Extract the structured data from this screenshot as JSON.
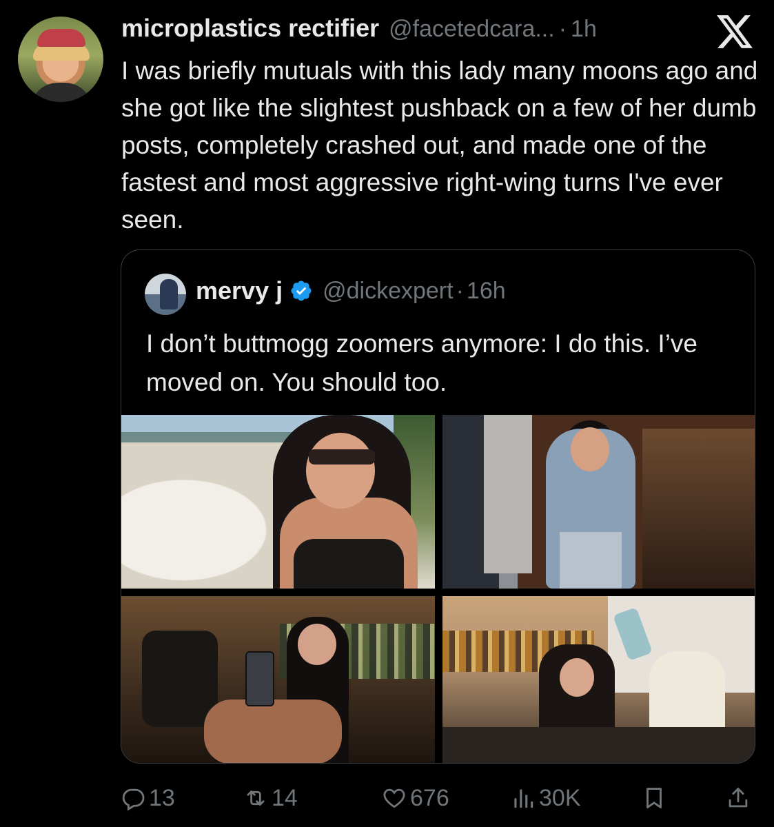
{
  "tweet": {
    "display_name": "microplastics rectifier",
    "handle": "@facetedcara...",
    "separator": "·",
    "time": "1h",
    "text": "I was briefly mutuals with this lady many moons ago and she got like the slightest pushback on a few of her dumb posts, completely crashed out, and made one of the fastest and most aggressive right-wing turns I've ever seen."
  },
  "quote": {
    "display_name": "mervy j",
    "handle": "@dickexpert",
    "separator": "·",
    "time": "16h",
    "text": "I don’t buttmogg zoomers anymore: I do this. I’ve moved on. You should too."
  },
  "actions": {
    "replies": "13",
    "reposts": "14",
    "likes": "676",
    "views": "30K"
  },
  "icons": {
    "logo": "x-logo-icon",
    "verified": "verified-badge-icon",
    "reply": "reply-icon",
    "repost": "repost-icon",
    "like": "heart-icon",
    "views": "views-icon",
    "bookmark": "bookmark-icon",
    "share": "share-icon"
  },
  "colors": {
    "background": "#000000",
    "text_primary": "#e7e9ea",
    "text_secondary": "#71767b",
    "verified_blue": "#1d9bf0",
    "border": "#3a3f44"
  }
}
